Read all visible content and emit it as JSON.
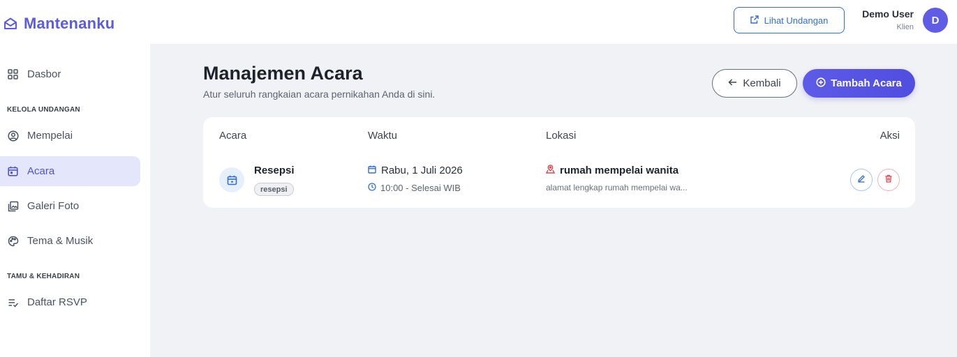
{
  "brand": {
    "name": "Mantenanku",
    "icon": "envelope-icon",
    "color": "#5b5ce2"
  },
  "sidebar": {
    "items": [
      {
        "label": "Dasbor",
        "icon": "dashboard-grid-icon"
      },
      {
        "label": "Mempelai",
        "icon": "user-circle-icon"
      },
      {
        "label": "Acara",
        "icon": "calendar-icon",
        "active": true
      },
      {
        "label": "Galeri Foto",
        "icon": "photo-library-icon"
      },
      {
        "label": "Tema & Musik",
        "icon": "palette-icon"
      },
      {
        "label": "Daftar RSVP",
        "icon": "checklist-icon"
      }
    ],
    "sections": [
      {
        "label": "KELOLA UNDANGAN"
      },
      {
        "label": "TAMU & KEHADIRAN"
      }
    ]
  },
  "topbar": {
    "view_invitation_label": "Lihat Undangan",
    "user_name": "Demo User",
    "user_role": "Klien",
    "avatar_initial": "D"
  },
  "page": {
    "title": "Manajemen Acara",
    "subtitle": "Atur seluruh rangkaian acara pernikahan Anda di sini.",
    "back_label": "Kembali",
    "add_label": "Tambah Acara"
  },
  "table": {
    "headers": [
      "Acara",
      "Waktu",
      "Lokasi",
      "Aksi"
    ],
    "rows": [
      {
        "name": "Resepsi",
        "tag": "resepsi",
        "date": "Rabu, 1 Juli 2026",
        "time": "10:00 - Selesai WIB",
        "location": "rumah mempelai wanita",
        "address": "alamat lengkap rumah mempelai wa..."
      }
    ]
  },
  "colors": {
    "accent": "#5b5ce2",
    "link_blue": "#2f6fd6",
    "danger": "#e0454f",
    "background": "#f1f2f5"
  }
}
